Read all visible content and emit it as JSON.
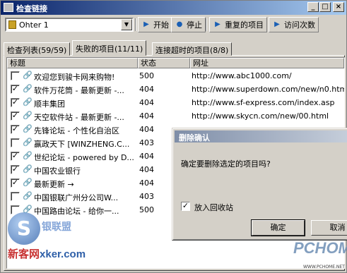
{
  "window": {
    "title": "检查链接"
  },
  "toolbar": {
    "combo_value": "Ohter 1",
    "start_label": "开始",
    "stop_label": "停止",
    "duplicates_label": "重复的项目",
    "visits_label": "访问次数"
  },
  "tabs": [
    {
      "label": "检查列表(59/59)"
    },
    {
      "label": "失败的项目(11/11)"
    },
    {
      "label": "连接超时的项目(8/8)"
    }
  ],
  "columns": {
    "title": "标题",
    "status": "状态",
    "url": "网址"
  },
  "rows": [
    {
      "checked": false,
      "title": "欢迎您到骏卡网来购物!",
      "status": "500",
      "url": "http://www.abc1000.com/"
    },
    {
      "checked": true,
      "title": "软件万花筒 - 最新更新 -...",
      "status": "404",
      "url": "http://www.superdown.com/new/n0.htm"
    },
    {
      "checked": true,
      "title": "顺丰集团",
      "status": "404",
      "url": "http://www.sf-express.com/index.asp"
    },
    {
      "checked": true,
      "title": "天空软件站 - 最新更新 -...",
      "status": "404",
      "url": "http://www.skycn.com/new/00.html"
    },
    {
      "checked": true,
      "title": "先锋论坛 - 个性化自治区",
      "status": "404",
      "url": ""
    },
    {
      "checked": false,
      "title": "赢政天下 [WINZHENG.C...",
      "status": "403",
      "url": ""
    },
    {
      "checked": true,
      "title": "世纪论坛 - powered by D...",
      "status": "404",
      "url": ""
    },
    {
      "checked": true,
      "title": "中国农业银行",
      "status": "404",
      "url": ""
    },
    {
      "checked": true,
      "title": "最新更新 →",
      "status": "404",
      "url": ""
    },
    {
      "checked": false,
      "title": "中国银联广州分公司W...",
      "status": "403",
      "url": ""
    },
    {
      "checked": false,
      "title": "中国路由论坛 - 给你一...",
      "status": "500",
      "url": ""
    }
  ],
  "dialog": {
    "title": "删除确认",
    "message": "确定要删除选定的项目吗?",
    "checkbox_label": "放入回收站",
    "checkbox_checked": true,
    "ok_label": "确定",
    "cancel_label": "取消"
  },
  "watermarks": {
    "left_cn": "银联盟",
    "left_site": "新客网",
    "left_site2": "xker.com",
    "right_brand": "PCHOME",
    "right_url": "WWW.PCHOME.NET"
  },
  "icons": {
    "combo": "folder-icon",
    "start": "play-icon",
    "stop": "stop-icon",
    "duplicates": "play-icon",
    "visits": "play-icon",
    "row": "link-icon"
  }
}
